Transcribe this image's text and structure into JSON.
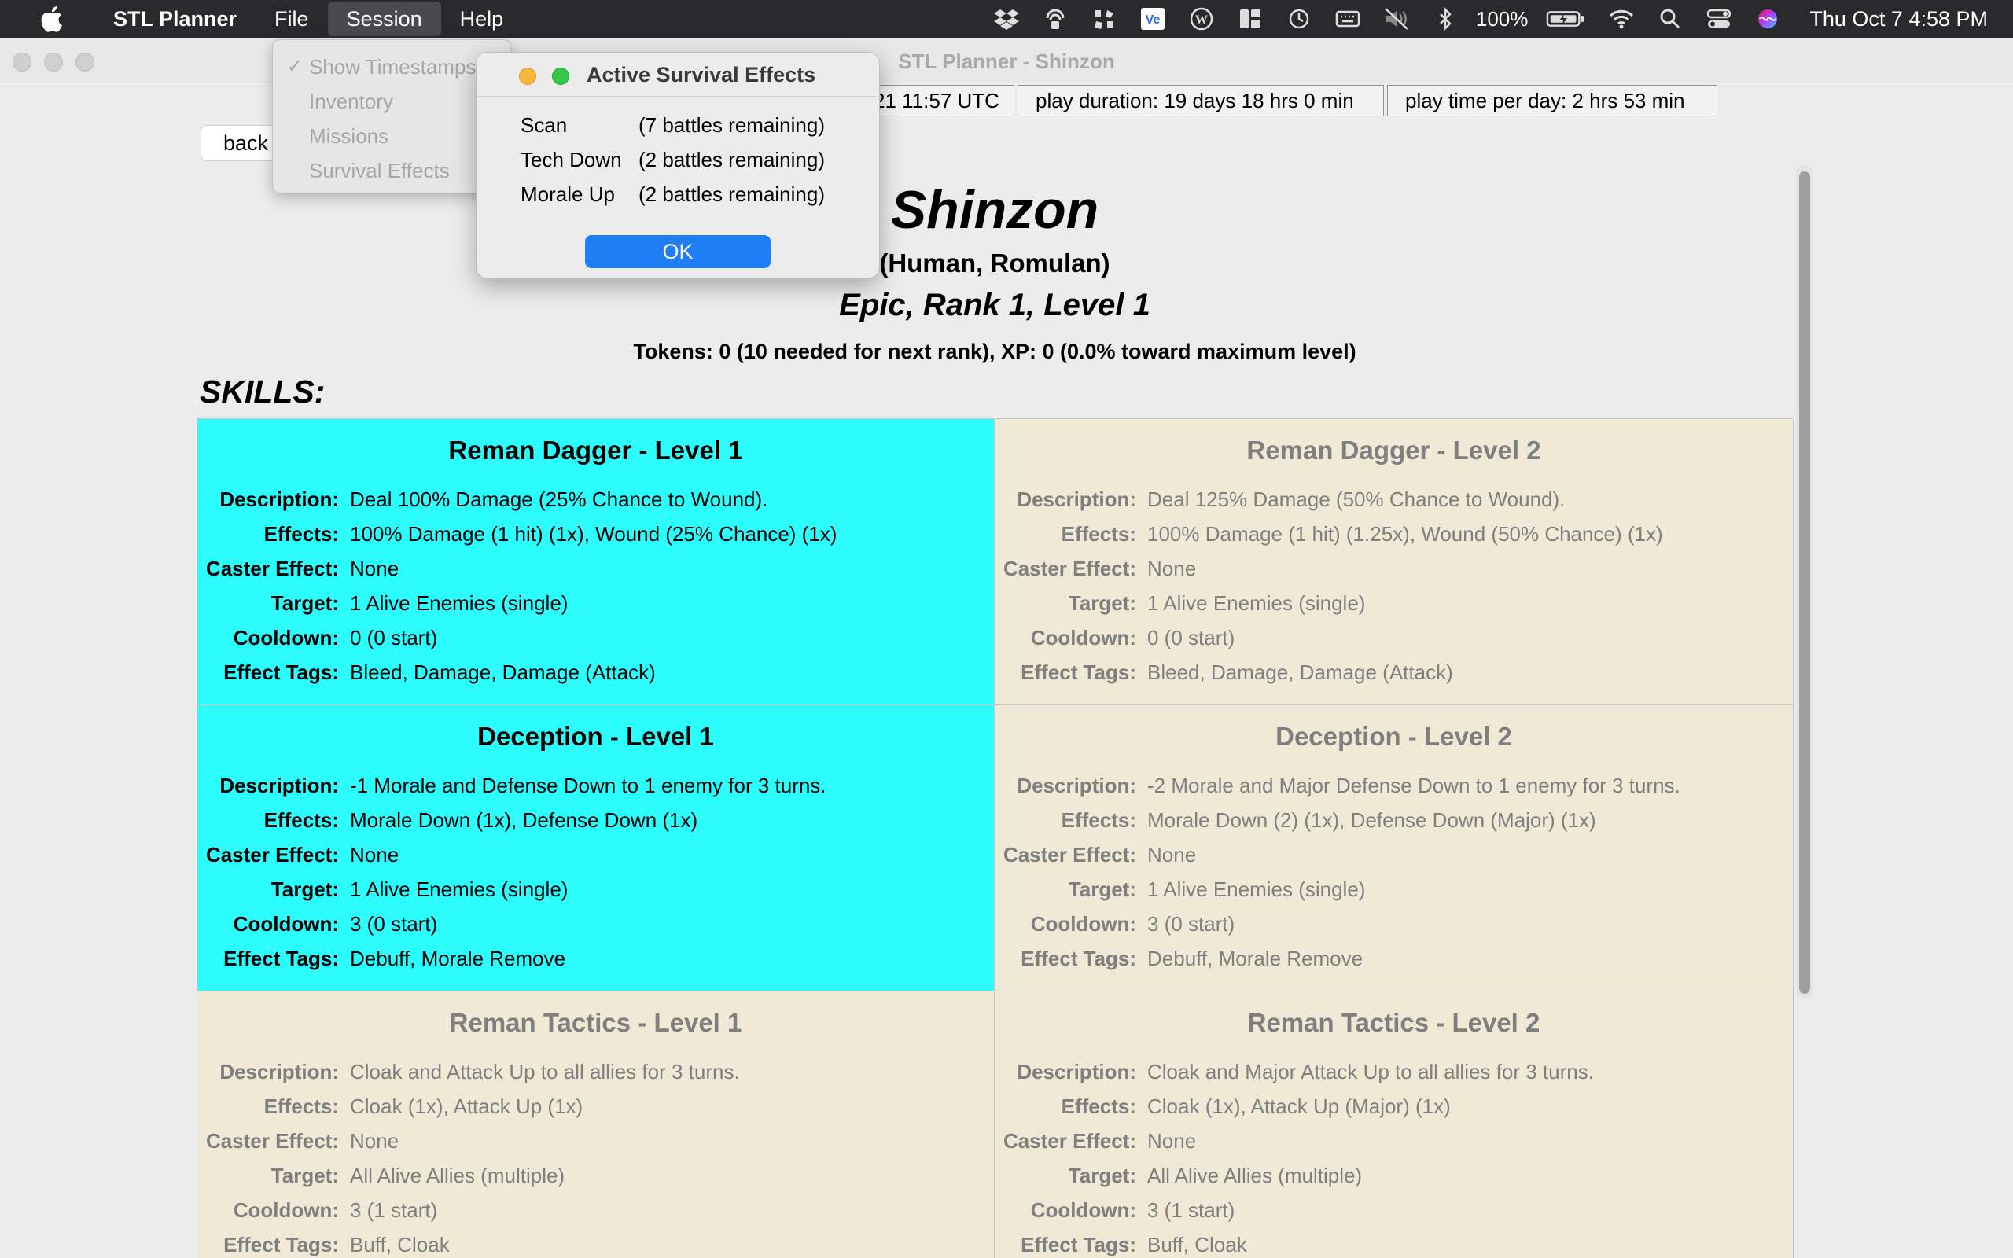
{
  "menubar": {
    "app_name": "STL Planner",
    "menus": [
      "File",
      "Session",
      "Help"
    ],
    "active_menu": "Session",
    "battery": "100%",
    "clock": "Thu Oct 7  4:58 PM",
    "status_icons": [
      "dropbox-icon",
      "radar-icon",
      "app-icon",
      "vectorworks-icon",
      "wordpress-icon",
      "layout-icon",
      "time-machine-icon",
      "keyboard-icon",
      "volume-mute-icon",
      "bluetooth-icon",
      "battery-icon",
      "wifi-icon",
      "spotlight-icon",
      "control-center-icon",
      "siri-icon"
    ]
  },
  "session_menu": {
    "items": [
      {
        "label": "Show Timestamps",
        "checked": true
      },
      {
        "label": "Inventory",
        "checked": false
      },
      {
        "label": "Missions",
        "checked": false
      },
      {
        "label": "Survival Effects",
        "checked": false
      }
    ]
  },
  "window": {
    "title": "STL Planner - Shinzon",
    "status": {
      "timestamp": "21 11:57 UTC",
      "play_duration": "play duration: 19 days 18 hrs 0 min",
      "play_time_per_day": "play time per day: 2 hrs 53 min"
    },
    "back_label": "back"
  },
  "dialog": {
    "title": "Active Survival Effects",
    "effects": [
      {
        "name": "Scan",
        "remaining": "(7 battles remaining)"
      },
      {
        "name": "Tech Down",
        "remaining": "(2 battles remaining)"
      },
      {
        "name": "Morale Up",
        "remaining": "(2 battles remaining)"
      }
    ],
    "ok_label": "OK"
  },
  "character": {
    "name": "Shinzon",
    "species": "(Human, Romulan)",
    "rank_line": "Epic, Rank 1, Level 1",
    "tokens_line": "Tokens: 0 (10 needed for next rank), XP: 0 (0.0% toward maximum level)"
  },
  "skills_heading": "SKILLS:",
  "field_labels": {
    "description": "Description:",
    "effects": "Effects:",
    "caster_effect": "Caster Effect:",
    "target": "Target:",
    "cooldown": "Cooldown:",
    "effect_tags": "Effect Tags:"
  },
  "skills": [
    {
      "title": "Reman Dagger - Level 1",
      "state": "active",
      "description": "Deal 100% Damage (25% Chance to Wound).",
      "effects": "100% Damage (1 hit) (1x), Wound (25% Chance) (1x)",
      "caster_effect": "None",
      "target": "1 Alive Enemies (single)",
      "cooldown": "0 (0 start)",
      "effect_tags": "Bleed, Damage, Damage (Attack)"
    },
    {
      "title": "Reman Dagger - Level 2",
      "state": "locked",
      "description": "Deal 125% Damage (50% Chance to Wound).",
      "effects": "100% Damage (1 hit) (1.25x), Wound (50% Chance) (1x)",
      "caster_effect": "None",
      "target": "1 Alive Enemies (single)",
      "cooldown": "0 (0 start)",
      "effect_tags": "Bleed, Damage, Damage (Attack)"
    },
    {
      "title": "Deception - Level 1",
      "state": "active",
      "description": "-1 Morale and Defense Down to 1 enemy for 3 turns.",
      "effects": "Morale Down (1x), Defense Down (1x)",
      "caster_effect": "None",
      "target": "1 Alive Enemies (single)",
      "cooldown": "3 (0 start)",
      "effect_tags": "Debuff, Morale Remove"
    },
    {
      "title": "Deception - Level 2",
      "state": "locked",
      "description": "-2 Morale and Major Defense Down to 1 enemy for 3 turns.",
      "effects": "Morale Down (2) (1x), Defense Down (Major) (1x)",
      "caster_effect": "None",
      "target": "1 Alive Enemies (single)",
      "cooldown": "3 (0 start)",
      "effect_tags": "Debuff, Morale Remove"
    },
    {
      "title": "Reman Tactics - Level 1",
      "state": "locked",
      "description": "Cloak and Attack Up to all allies for 3 turns.",
      "effects": "Cloak (1x), Attack Up (1x)",
      "caster_effect": "None",
      "target": "All Alive Allies (multiple)",
      "cooldown": "3 (1 start)",
      "effect_tags": "Buff, Cloak"
    },
    {
      "title": "Reman Tactics - Level 2",
      "state": "locked",
      "description": "Cloak and Major Attack Up to all allies for 3 turns.",
      "effects": "Cloak (1x), Attack Up (Major) (1x)",
      "caster_effect": "None",
      "target": "All Alive Allies (multiple)",
      "cooldown": "3 (1 start)",
      "effect_tags": "Buff, Cloak"
    }
  ],
  "colors": {
    "active_card": "#2cfcfc",
    "locked_card": "#efe9d6",
    "accent": "#1f7df6",
    "menubar": "#2a2a2c"
  }
}
